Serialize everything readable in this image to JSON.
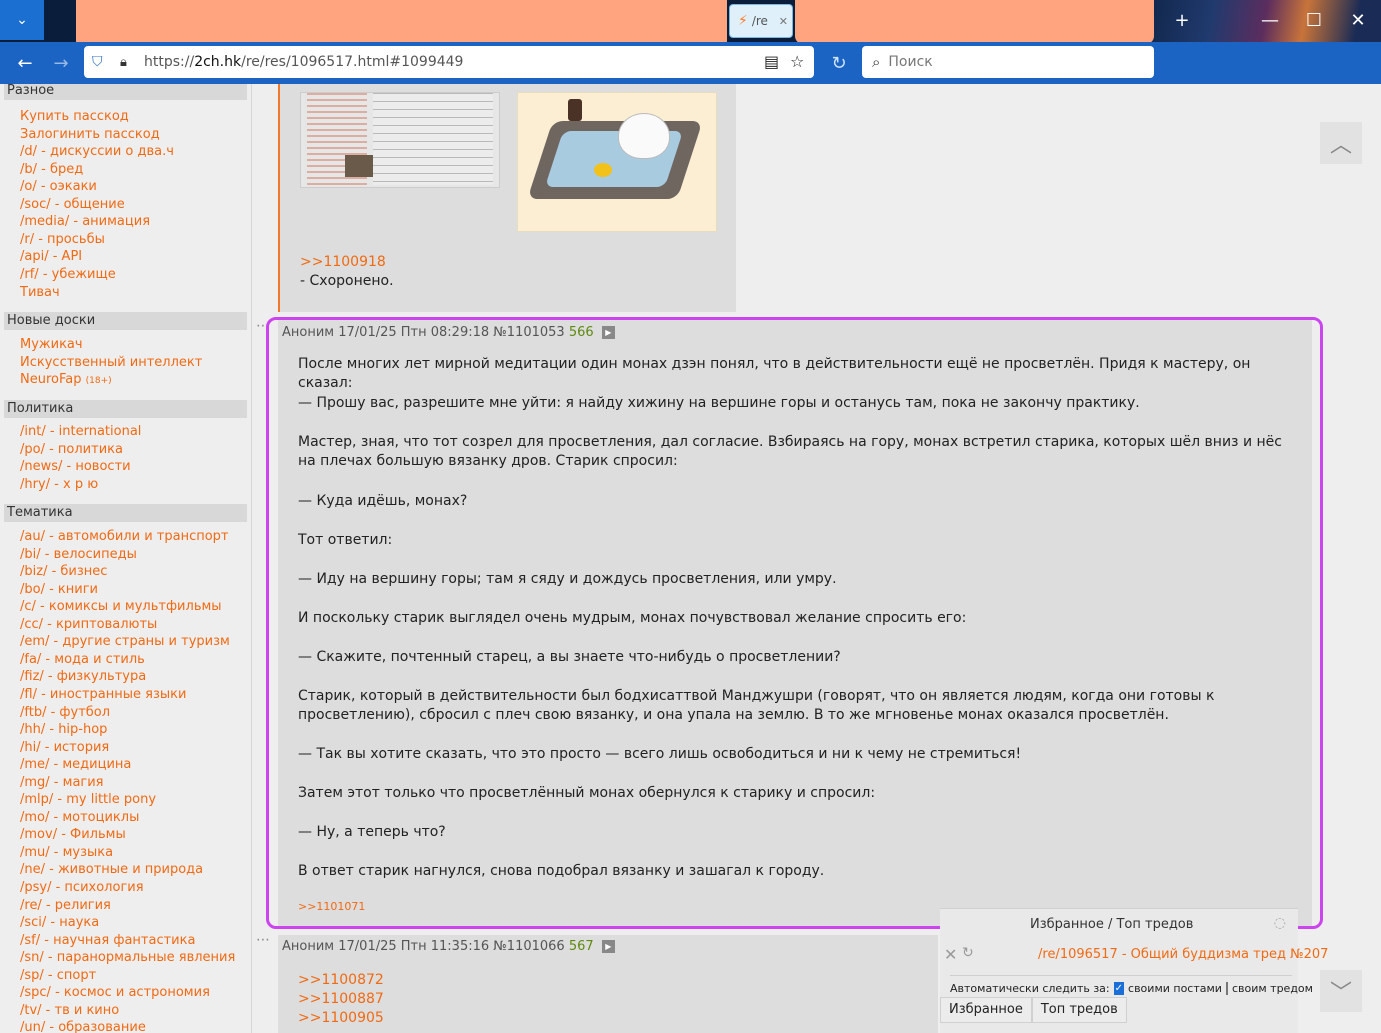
{
  "browser": {
    "tab_title": "/re",
    "url_prefix": "https://",
    "url_host": "2ch.hk",
    "url_path": "/re/res/1096517.html#1099449",
    "search_placeholder": "Поиск"
  },
  "sidebar": {
    "sections": [
      {
        "title": "Разное",
        "links": [
          "Купить пасскод",
          "Залогинить пасскод",
          "/d/ - дискуссии о два.ч",
          "/b/ - бред",
          "/o/ - оэкаки",
          "/soc/ - общение",
          "/media/ - анимация",
          "/r/ - просьбы",
          "/api/ - API",
          "/rf/ - убежище",
          "Тивач"
        ]
      },
      {
        "title": "Новые доски",
        "links": [
          "Мужикач",
          "Искусственный интеллект",
          "NeuroFap"
        ],
        "neurofap_badge": "(18+)"
      },
      {
        "title": "Политика",
        "links": [
          "/int/ - international",
          "/po/ - политика",
          "/news/ - новости",
          "/hry/ - х р ю"
        ]
      },
      {
        "title": "Тематика",
        "links": [
          "/au/ - автомобили и транспорт",
          "/bi/ - велосипеды",
          "/biz/ - бизнес",
          "/bo/ - книги",
          "/c/ - комиксы и мультфильмы",
          "/cc/ - криптовалюты",
          "/em/ - другие страны и туризм",
          "/fa/ - мода и стиль",
          "/fiz/ - физкультура",
          "/fl/ - иностранные языки",
          "/ftb/ - футбол",
          "/hh/ - hip-hop",
          "/hi/ - история",
          "/me/ - медицина",
          "/mg/ - магия",
          "/mlp/ - my little pony",
          "/mo/ - мотоциклы",
          "/mov/ - Фильмы",
          "/mu/ - музыка",
          "/ne/ - животные и природа",
          "/psy/ - психология",
          "/re/ - религия",
          "/sci/ - наука",
          "/sf/ - научная фантастика",
          "/sn/ - паранормальные явления",
          "/sp/ - спорт",
          "/spc/ - космос и астрономия",
          "/tv/ - тв и кино",
          "/un/ - образование"
        ]
      }
    ]
  },
  "posts": {
    "prev": {
      "reply_link": ">>1100918",
      "text": "- Схоронено."
    },
    "main": {
      "author": "Аноним",
      "date": "17/01/25 Птн 08:29:18",
      "id": "№1101053",
      "num": "566",
      "paragraphs": [
        "После многих лет мирной медитации один монах дзэн понял, что в действительности ещё не просветлён. Придя к мастеру, он сказал:",
        "— Прошу вас, разрешите мне уйти: я найду хижину на вершине горы и останусь там, пока не закончу практику.",
        "Мастер, зная, что тот созрел для просветления, дал согласие. Взбираясь на гору, монах встретил старика, которых шёл вниз и нёс на плечах большую вязанку дров. Старик спросил:",
        "— Куда идёшь, монах?",
        "Тот ответил:",
        "— Иду на вершину горы; там я сяду и дождусь просветления, или умру.",
        "И поскольку старик выглядел очень мудрым, монах почувствовал желание спросить его:",
        "— Скажите, почтенный старец, а вы знаете что-нибудь о просветлении?",
        "Старик, который в действительности был бодхисаттвой Манджушри (говорят, что он является людям, когда они готовы к просветлению), сбросил с плеч свою вязанку, и она упала на землю. В то же мгновенье монах оказался просветлён.",
        "— Так вы хотите сказать, что это просто — всего лишь освободиться и ни к чему не стремиться!",
        "Затем этот только что просветлённый монах обернулся к старику и спросил:",
        "— Ну, а теперь что?",
        "В ответ старик нагнулся, снова подобрал вязанку и зашагал к городу."
      ],
      "backlink": ">>1101071"
    },
    "next": {
      "author": "Аноним",
      "date": "17/01/25 Птн 11:35:16",
      "id": "№1101066",
      "num": "567",
      "replies": [
        ">>1100872",
        ">>1100887",
        ">>1100905"
      ]
    }
  },
  "fav_panel": {
    "title": "Избранное / Топ тредов",
    "thread": "/re/1096517 - Общий буддизма тред №207",
    "auto_label": "Автоматически следить за:",
    "opt_own_posts": "своими постами",
    "opt_own_thread": "своим тредом",
    "tab_fav": "Избранное",
    "tab_top": "Топ тредов"
  },
  "colors": {
    "accent": "#f06a12",
    "highlight": "#cc44ee",
    "post_bg": "#dddddd"
  }
}
